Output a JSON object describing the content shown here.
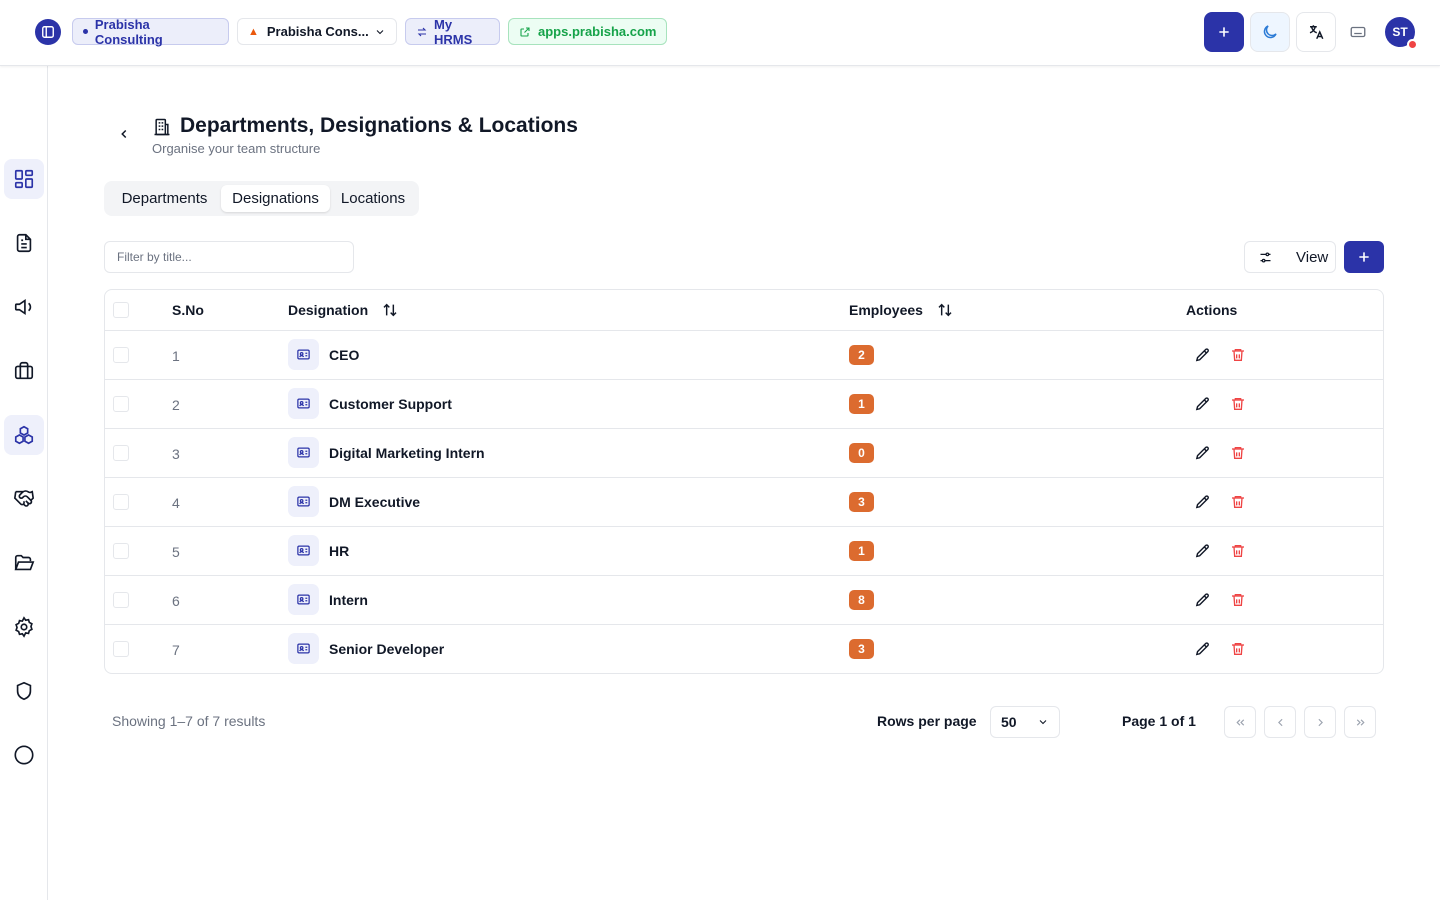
{
  "topbar": {
    "org_chip": "Prabisha Consulting",
    "company_select": "Prabisha Cons...",
    "hrms_chip": "My HRMS",
    "site_chip": "apps.prabisha.com",
    "avatar_initials": "ST"
  },
  "header": {
    "title": "Departments, Designations & Locations",
    "subtitle": "Organise your team structure"
  },
  "tabs": [
    {
      "label": "Departments",
      "active": false
    },
    {
      "label": "Designations",
      "active": true
    },
    {
      "label": "Locations",
      "active": false
    }
  ],
  "toolbar": {
    "filter_placeholder": "Filter by title...",
    "filter_value": "",
    "view_label": "View"
  },
  "table": {
    "headers": {
      "sno": "S.No",
      "designation": "Designation",
      "employees": "Employees",
      "actions": "Actions"
    },
    "rows": [
      {
        "sno": "1",
        "designation": "CEO",
        "employees": "2"
      },
      {
        "sno": "2",
        "designation": "Customer Support",
        "employees": "1"
      },
      {
        "sno": "3",
        "designation": "Digital Marketing Intern",
        "employees": "0"
      },
      {
        "sno": "4",
        "designation": "DM Executive",
        "employees": "3"
      },
      {
        "sno": "5",
        "designation": "HR",
        "employees": "1"
      },
      {
        "sno": "6",
        "designation": "Intern",
        "employees": "8"
      },
      {
        "sno": "7",
        "designation": "Senior Developer",
        "employees": "3"
      }
    ]
  },
  "footer": {
    "results_text": "Showing 1–7 of 7 results",
    "rows_per_page_label": "Rows per page",
    "rows_per_page_value": "50",
    "page_info": "Page 1 of 1"
  },
  "colors": {
    "primary": "#2b33a8",
    "badge": "#dc6b2f",
    "delete": "#ef4444",
    "site_green": "#16a34a"
  },
  "sidebar_icons": [
    "dashboard-icon",
    "document-icon",
    "megaphone-icon",
    "briefcase-icon",
    "boxes-icon",
    "handshake-icon",
    "folder-icon",
    "settings-icon",
    "shield-icon",
    "circle-icon"
  ]
}
